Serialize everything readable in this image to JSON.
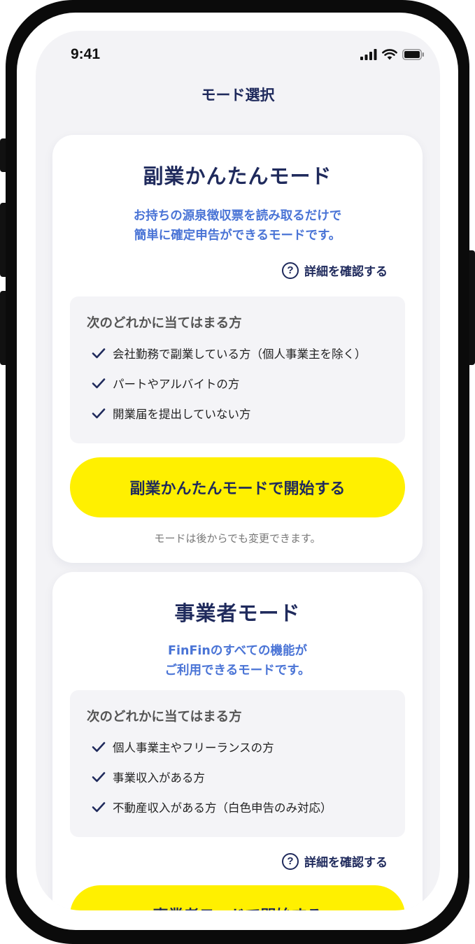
{
  "status_bar": {
    "time": "9:41"
  },
  "nav": {
    "title": "モード選択"
  },
  "cards": [
    {
      "title": "副業かんたんモード",
      "description_lines": [
        "お持ちの源泉徴収票を読み取るだけで",
        "簡単に確定申告ができるモードです。"
      ],
      "detail_link": "詳細を確認する",
      "condition_heading": "次のどれかに当てはまる方",
      "conditions": [
        "会社勤務で副業している方（個人事業主を除く）",
        "パートやアルバイトの方",
        "開業届を提出していない方"
      ],
      "cta": "副業かんたんモードで開始する",
      "note": "モードは後からでも変更できます。"
    },
    {
      "title": "事業者モード",
      "description_lines": [
        "FinFinのすべての機能が",
        "ご利用できるモードです。"
      ],
      "condition_heading": "次のどれかに当てはまる方",
      "conditions": [
        "個人事業主やフリーランスの方",
        "事業収入がある方",
        "不動産収入がある方（白色申告のみ対応）"
      ],
      "detail_link": "詳細を確認する",
      "cta": "事業者モードで開始する"
    }
  ],
  "icons": {
    "help": "question-circle-icon",
    "check": "check-icon",
    "signal": "signal-icon",
    "wifi": "wifi-icon",
    "battery": "battery-icon"
  },
  "colors": {
    "navy": "#1f2a5c",
    "accent_blue": "#4a74d6",
    "cta_yellow": "#fff000",
    "screen_bg": "#f3f3f6"
  }
}
